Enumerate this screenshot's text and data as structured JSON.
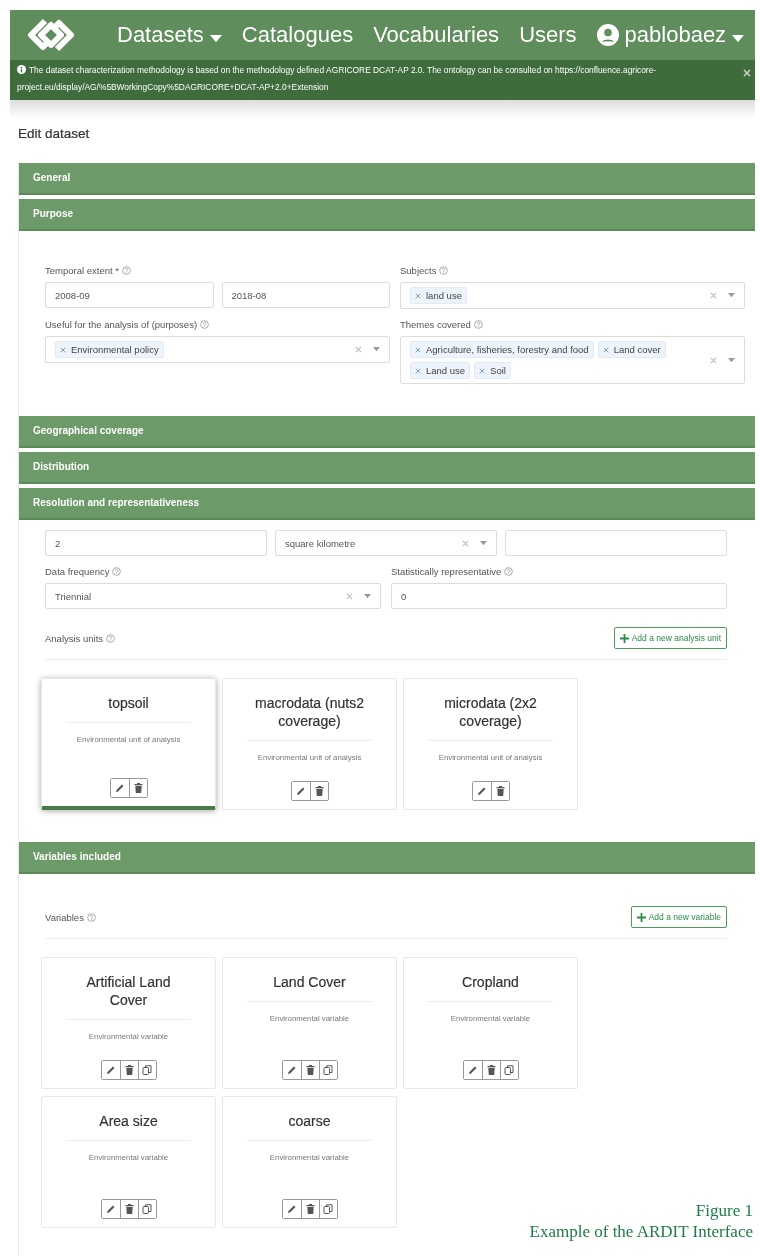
{
  "navbar": {
    "menu": [
      {
        "label": "Datasets",
        "dropdown": true,
        "kind": "menu"
      },
      {
        "label": "Catalogues",
        "dropdown": false,
        "kind": "menu"
      },
      {
        "label": "Vocabularies",
        "dropdown": false,
        "kind": "menu"
      },
      {
        "label": "Users",
        "dropdown": false,
        "kind": "menu"
      },
      {
        "label": "pablobaez",
        "dropdown": true,
        "kind": "user"
      }
    ]
  },
  "alert": {
    "text": "The dataset characterization methodology is based on the methodology defined AGRICORE DCAT-AP 2.0. The ontology can be consulted on https://confluence.agricore-project.eu/display/AG/%5BWorkingCopy%5DAGRICORE+DCAT-AP+2.0+Extension"
  },
  "page_title": "Edit dataset",
  "sections": [
    {
      "title": "General"
    },
    {
      "title": "Purpose",
      "fields": [
        {
          "label": "Temporal extent *",
          "help": true,
          "controls": [
            {
              "kind": "text",
              "value": "2008-09"
            },
            {
              "kind": "text",
              "value": "2018-08"
            }
          ]
        },
        {
          "label": "Subjects",
          "help": true,
          "controls": [
            {
              "kind": "multi",
              "tags": [
                "land use"
              ]
            }
          ]
        },
        {
          "label": "Useful for the analysis of (purposes)",
          "help": true,
          "controls": [
            {
              "kind": "multi",
              "tags": [
                "Environmental policy"
              ]
            }
          ]
        },
        {
          "label": "Themes covered",
          "help": true,
          "controls": [
            {
              "kind": "multi",
              "tags": [
                "Agriculture, fisheries, forestry and food",
                "Land cover",
                "Land use",
                "Soil"
              ]
            }
          ]
        }
      ]
    },
    {
      "title": "Geographical coverage"
    },
    {
      "title": "Distribution"
    },
    {
      "title": "Resolution and representativeness",
      "fields": [
        {
          "controls": [
            {
              "kind": "text",
              "value": "2"
            },
            {
              "kind": "select",
              "value": "square kilometre"
            },
            {
              "kind": "text"
            }
          ]
        },
        {
          "label": "Data frequency",
          "help": true,
          "controls": [
            {
              "kind": "select",
              "value": "Triennial"
            }
          ]
        },
        {
          "label": "Statistically representative",
          "help": true,
          "controls": [
            {
              "kind": "text",
              "value": "0"
            }
          ]
        }
      ],
      "list": {
        "label": "Analysis units",
        "help": true,
        "add_button": "Add a new analysis unit",
        "cards": [
          {
            "title": "topsoil",
            "subtitle": "Environmental unit of analysis",
            "selected": true,
            "copyable": false
          },
          {
            "title": "macrodata (nuts2 coverage)",
            "subtitle": "Environmental unit of analysis",
            "selected": false,
            "copyable": false
          },
          {
            "title": "microdata (2x2 coverage)",
            "subtitle": "Environmental unit of analysis",
            "selected": false,
            "copyable": false
          }
        ]
      }
    },
    {
      "title": "Variables included",
      "list": {
        "label": "Variables",
        "help": true,
        "add_button": "Add a new variable",
        "cards": [
          {
            "title": "Artificial Land Cover",
            "subtitle": "Environmental variable",
            "selected": false,
            "copyable": true
          },
          {
            "title": "Land Cover",
            "subtitle": "Environmental variable",
            "selected": false,
            "copyable": true
          },
          {
            "title": "Cropland",
            "subtitle": "Environmental variable",
            "selected": false,
            "copyable": true
          },
          {
            "title": "Area size",
            "subtitle": "Environmental variable",
            "selected": false,
            "copyable": true
          },
          {
            "title": "coarse",
            "subtitle": "Environmental variable",
            "selected": false,
            "copyable": true
          }
        ]
      }
    }
  ],
  "caption": {
    "figure": "Figure 1",
    "text": "Example of the ARDIT Interface"
  }
}
